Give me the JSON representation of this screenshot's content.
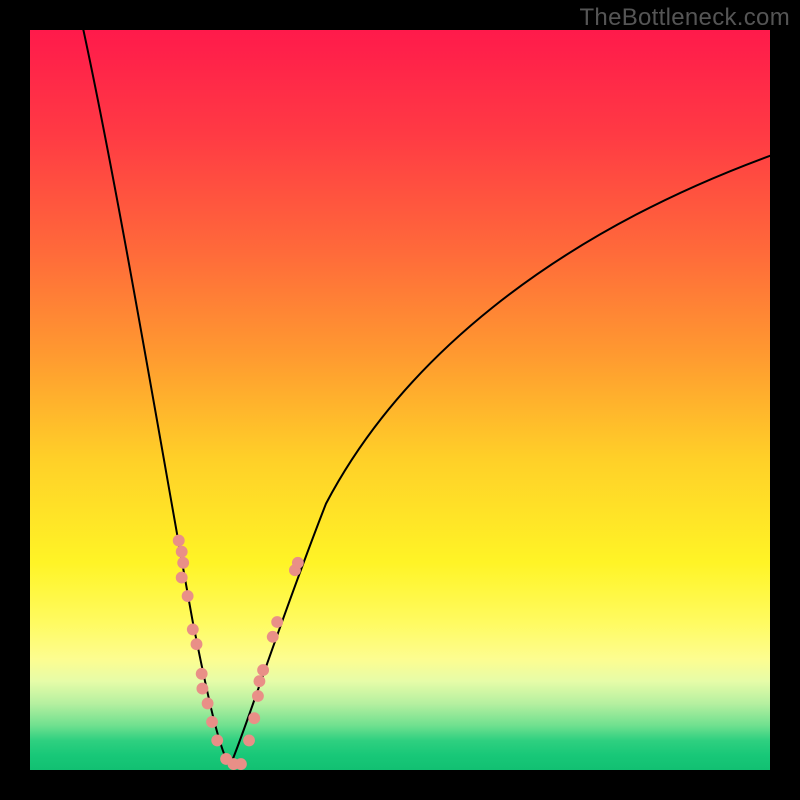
{
  "watermark": "TheBottleneck.com",
  "chart_data": {
    "type": "line",
    "title": "",
    "xlabel": "",
    "ylabel": "",
    "xlim": [
      0,
      100
    ],
    "ylim": [
      0,
      100
    ],
    "grid": false,
    "description": "Bottleneck V-curve: two black curves descending from top edges and meeting near the green bottom band at x≈27, with salmon data markers clustered along the lower portions of both curves.",
    "series": [
      {
        "name": "left-curve",
        "x": [
          8,
          10,
          12,
          14,
          16,
          18,
          20,
          22,
          24,
          26,
          27
        ],
        "y": [
          100,
          88,
          76,
          64,
          52,
          40,
          28,
          18,
          10,
          3,
          0
        ]
      },
      {
        "name": "right-curve",
        "x": [
          27,
          29,
          32,
          36,
          41,
          48,
          56,
          66,
          78,
          90,
          100
        ],
        "y": [
          0,
          5,
          14,
          26,
          38,
          50,
          60,
          68,
          75,
          80,
          83
        ]
      }
    ],
    "markers_left": [
      {
        "x": 20.1,
        "y": 31.0
      },
      {
        "x": 20.5,
        "y": 29.5
      },
      {
        "x": 20.7,
        "y": 28.0
      },
      {
        "x": 20.5,
        "y": 26.0
      },
      {
        "x": 21.3,
        "y": 23.5
      },
      {
        "x": 22.0,
        "y": 19.0
      },
      {
        "x": 22.5,
        "y": 17.0
      },
      {
        "x": 23.2,
        "y": 13.0
      },
      {
        "x": 23.3,
        "y": 11.0
      },
      {
        "x": 24.0,
        "y": 9.0
      },
      {
        "x": 24.6,
        "y": 6.5
      },
      {
        "x": 25.3,
        "y": 4.0
      },
      {
        "x": 26.5,
        "y": 1.5
      },
      {
        "x": 27.5,
        "y": 0.8
      },
      {
        "x": 28.5,
        "y": 0.8
      }
    ],
    "markers_right": [
      {
        "x": 29.6,
        "y": 4.0
      },
      {
        "x": 30.3,
        "y": 7.0
      },
      {
        "x": 30.8,
        "y": 10.0
      },
      {
        "x": 31.0,
        "y": 12.0
      },
      {
        "x": 31.5,
        "y": 13.5
      },
      {
        "x": 32.8,
        "y": 18.0
      },
      {
        "x": 33.4,
        "y": 20.0
      },
      {
        "x": 35.8,
        "y": 27.0
      },
      {
        "x": 36.2,
        "y": 28.0
      }
    ],
    "marker_radius_pct": 0.8
  }
}
